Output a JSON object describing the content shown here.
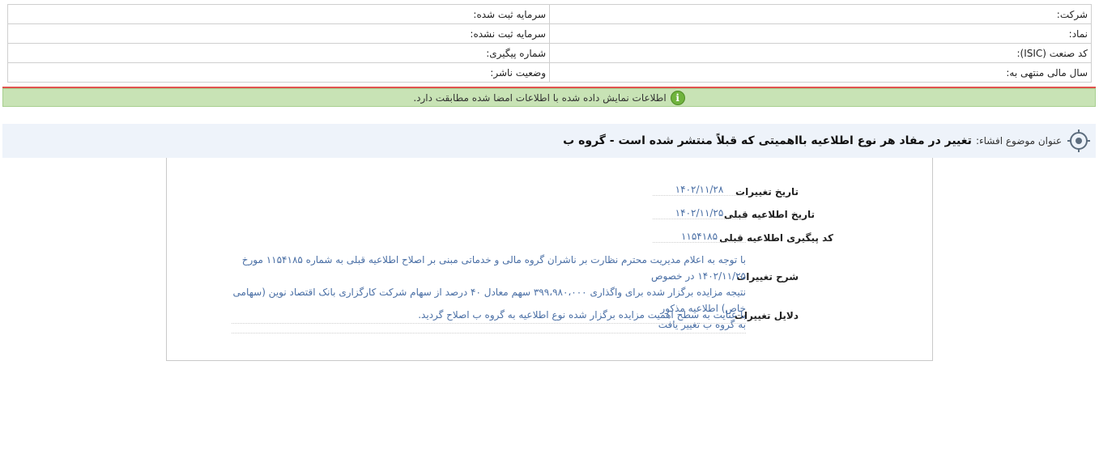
{
  "header_table": {
    "company_label": "شرکت:",
    "company_value": "",
    "registered_capital_label": "سرمایه ثبت شده:",
    "registered_capital_value": "",
    "symbol_label": "نماد:",
    "symbol_value": "",
    "unregistered_capital_label": "سرمایه ثبت نشده:",
    "unregistered_capital_value": "",
    "isic_label": "کد صنعت (ISIC):",
    "isic_value": "",
    "tracking_number_label": "شماره پیگیری:",
    "tracking_number_value": "",
    "fiscal_year_label": "سال مالی منتهی به:",
    "fiscal_year_value": "",
    "publisher_status_label": "وضعیت ناشر:",
    "publisher_status_value": ""
  },
  "notice": {
    "icon": "info-icon",
    "text": "اطلاعات نمایش داده شده با اطلاعات امضا شده مطابقت دارد.",
    "colors": {
      "background": "#c8e3b5",
      "icon": "#6fb33d"
    }
  },
  "subject": {
    "icon": "target-icon",
    "label": "عنوان موضوع افشاء:",
    "value": "تغییر در مفاد هر نوع اطلاعیه بااهمیتی که قبلاً منتشر شده است - گروه ب"
  },
  "details": {
    "change_date_label": "تاریخ تغییرات",
    "change_date_value": "۱۴۰۲/۱۱/۲۸",
    "previous_notice_date_label": "تاریخ اطلاعیه قبلی",
    "previous_notice_date_value": "۱۴۰۲/۱۱/۲۵",
    "previous_tracking_code_label": "کد پیگیری اطلاعیه قبلی",
    "previous_tracking_code_value": "۱۱۵۴۱۸۵",
    "description_label": "شرح تغییرات",
    "description_lines": [
      "با توجه به اعلام مدیریت محترم نظارت بر ناشران گروه مالی و خدماتی مبنی بر اصلاح اطلاعیه قبلی به شماره ۱۱۵۴۱۸۵ مورخ ۱۴۰۲/۱۱/۲۵ در خصوص",
      "نتیجه مزایده برگزار شده برای واگذاری ۳۹۹،۹۸۰،۰۰۰ سهم معادل ۴۰ درصد از سهام شرکت کارگزاری بانک اقتصاد نوین (سهامی خاص) اطلاعیه مذکور",
      "به گروه ب تغییر یافت"
    ],
    "reasons_label": "دلایل تغییرات",
    "reasons_value": "با عنایت به سطح اهمیت مزایده برگزار شده نوع اطلاعیه به گروه ب اصلاح گردید.",
    "colors": {
      "value_text": "#4a6fa5"
    }
  }
}
